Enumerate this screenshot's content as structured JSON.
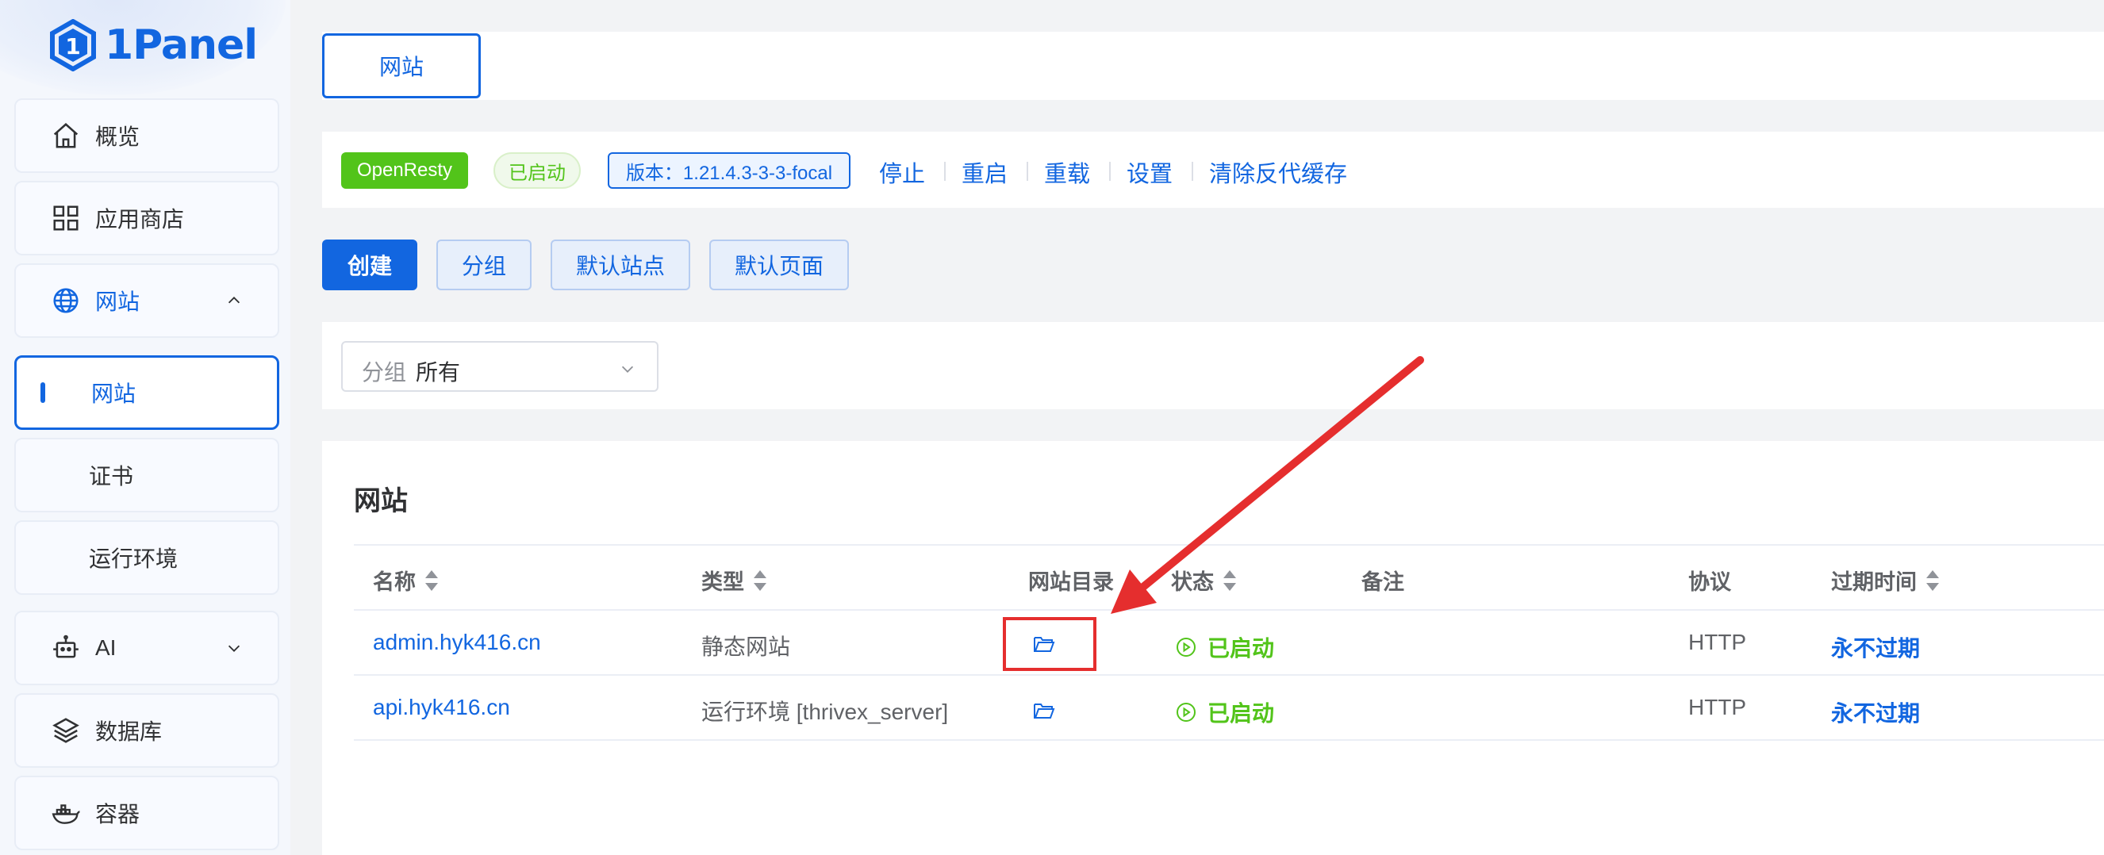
{
  "app": {
    "name": "1Panel",
    "brand_color": "#1266e0"
  },
  "sidebar": {
    "items": [
      {
        "label": "概览",
        "icon": "home-icon"
      },
      {
        "label": "应用商店",
        "icon": "grid-icon"
      },
      {
        "label": "网站",
        "icon": "globe-icon",
        "expanded": true
      },
      {
        "label": "网站",
        "active": true
      },
      {
        "label": "证书"
      },
      {
        "label": "运行环境"
      },
      {
        "label": "AI",
        "icon": "robot-icon",
        "expanded": false
      },
      {
        "label": "数据库",
        "icon": "layers-icon"
      },
      {
        "label": "容器",
        "icon": "docker-icon"
      }
    ]
  },
  "tabs": [
    {
      "label": "网站"
    }
  ],
  "openresty": {
    "name": "OpenResty",
    "status": "已启动",
    "version": "版本：1.21.4.3-3-3-focal",
    "actions": [
      "停止",
      "重启",
      "重载",
      "设置",
      "清除反代缓存"
    ]
  },
  "toolbar": {
    "create": "创建",
    "group": "分组",
    "default_site": "默认站点",
    "default_page": "默认页面"
  },
  "filter": {
    "label": "分组",
    "value": "所有"
  },
  "table": {
    "title": "网站",
    "columns": [
      "名称",
      "类型",
      "网站目录",
      "状态",
      "备注",
      "协议",
      "过期时间"
    ],
    "rows": [
      {
        "name": "admin.hyk416.cn",
        "type": "静态网站",
        "status": "已启动",
        "remark": "",
        "protocol": "HTTP",
        "expire": "永不过期"
      },
      {
        "name": "api.hyk416.cn",
        "type": "运行环境 [thrivex_server]",
        "status": "已启动",
        "remark": "",
        "protocol": "HTTP",
        "expire": "永不过期"
      }
    ]
  },
  "colors": {
    "success": "#52c41a",
    "annotation": "#e52e2e"
  }
}
